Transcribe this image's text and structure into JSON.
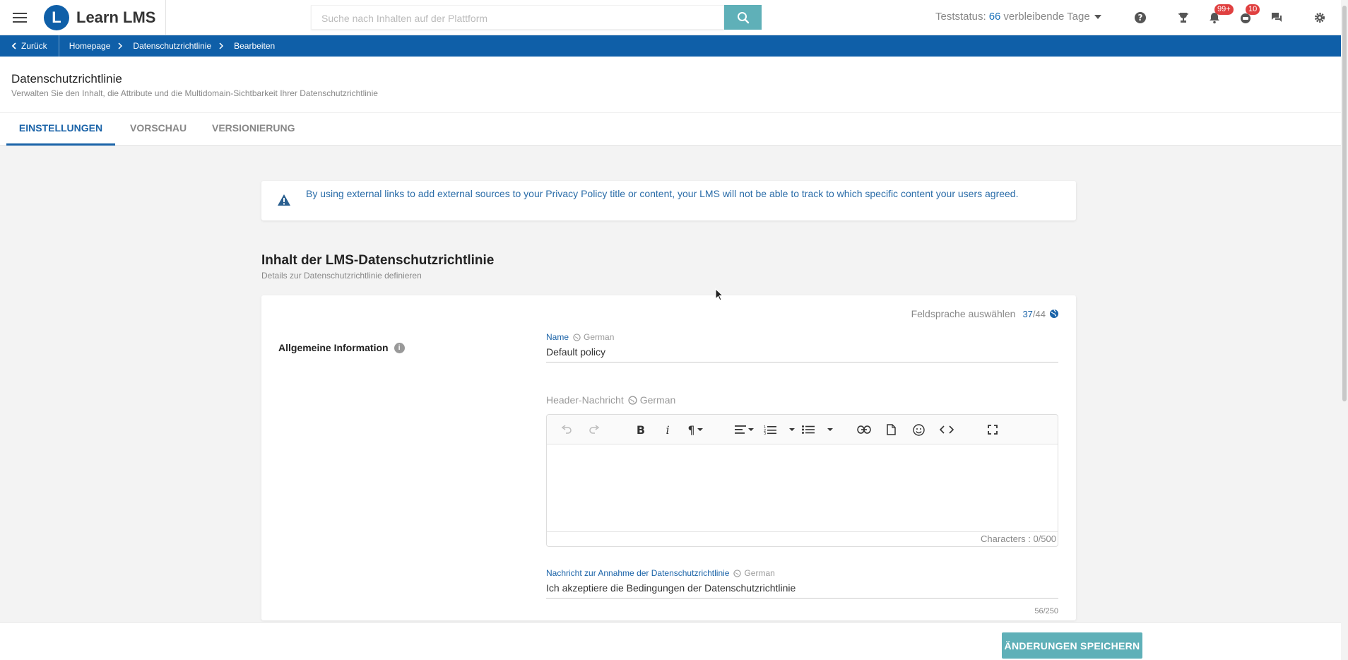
{
  "header": {
    "app_name": "Learn LMS",
    "logo_letter": "L",
    "search_placeholder": "Suche nach Inhalten auf der Plattform",
    "trial_prefix": "Teststatus:",
    "trial_days": "66",
    "trial_suffix": "verbleibende Tage",
    "notifications_badge": "99+",
    "messages_badge": "10"
  },
  "breadcrumb": {
    "back_label": "Zurück",
    "items": [
      "Homepage",
      "Datenschutzrichtlinie",
      "Bearbeiten"
    ]
  },
  "page": {
    "title": "Datenschutzrichtlinie",
    "subtitle": "Verwalten Sie den Inhalt, die Attribute und die Multidomain-Sichtbarkeit Ihrer Datenschutzrichtlinie"
  },
  "tabs": [
    {
      "label": "EINSTELLUNGEN",
      "active": true
    },
    {
      "label": "VORSCHAU",
      "active": false
    },
    {
      "label": "VERSIONIERUNG",
      "active": false
    }
  ],
  "alert": {
    "text": "By using external links to add external sources to your Privacy Policy title or content, your LMS will not be able to track to which specific content your users agreed."
  },
  "section": {
    "title": "Inhalt der LMS-Datenschutzrichtlinie",
    "subtitle": "Details zur Datenschutzrichtlinie definieren"
  },
  "card": {
    "lang_select_label": "Feldsprache auswählen",
    "lang_count": "37",
    "lang_total": "/44",
    "group_label": "Allgemeine Information",
    "name_field": {
      "label": "Name",
      "lang": "German",
      "value": "Default policy"
    },
    "header_field": {
      "label": "Header-Nachricht",
      "lang": "German",
      "char_counter": "Characters : 0/500"
    },
    "accept_field": {
      "label": "Nachricht zur Annahme der Datenschutzrichtlinie",
      "lang": "German",
      "value": "Ich akzeptiere die Bedingungen der Datenschutzrichtlinie",
      "counter": "56/250"
    }
  },
  "footer": {
    "save_label": "ÄNDERUNGEN SPEICHERN"
  },
  "colors": {
    "brand_blue": "#0f5fa8",
    "teal_button": "#5fb0b8",
    "link_blue": "#1a63a8"
  }
}
